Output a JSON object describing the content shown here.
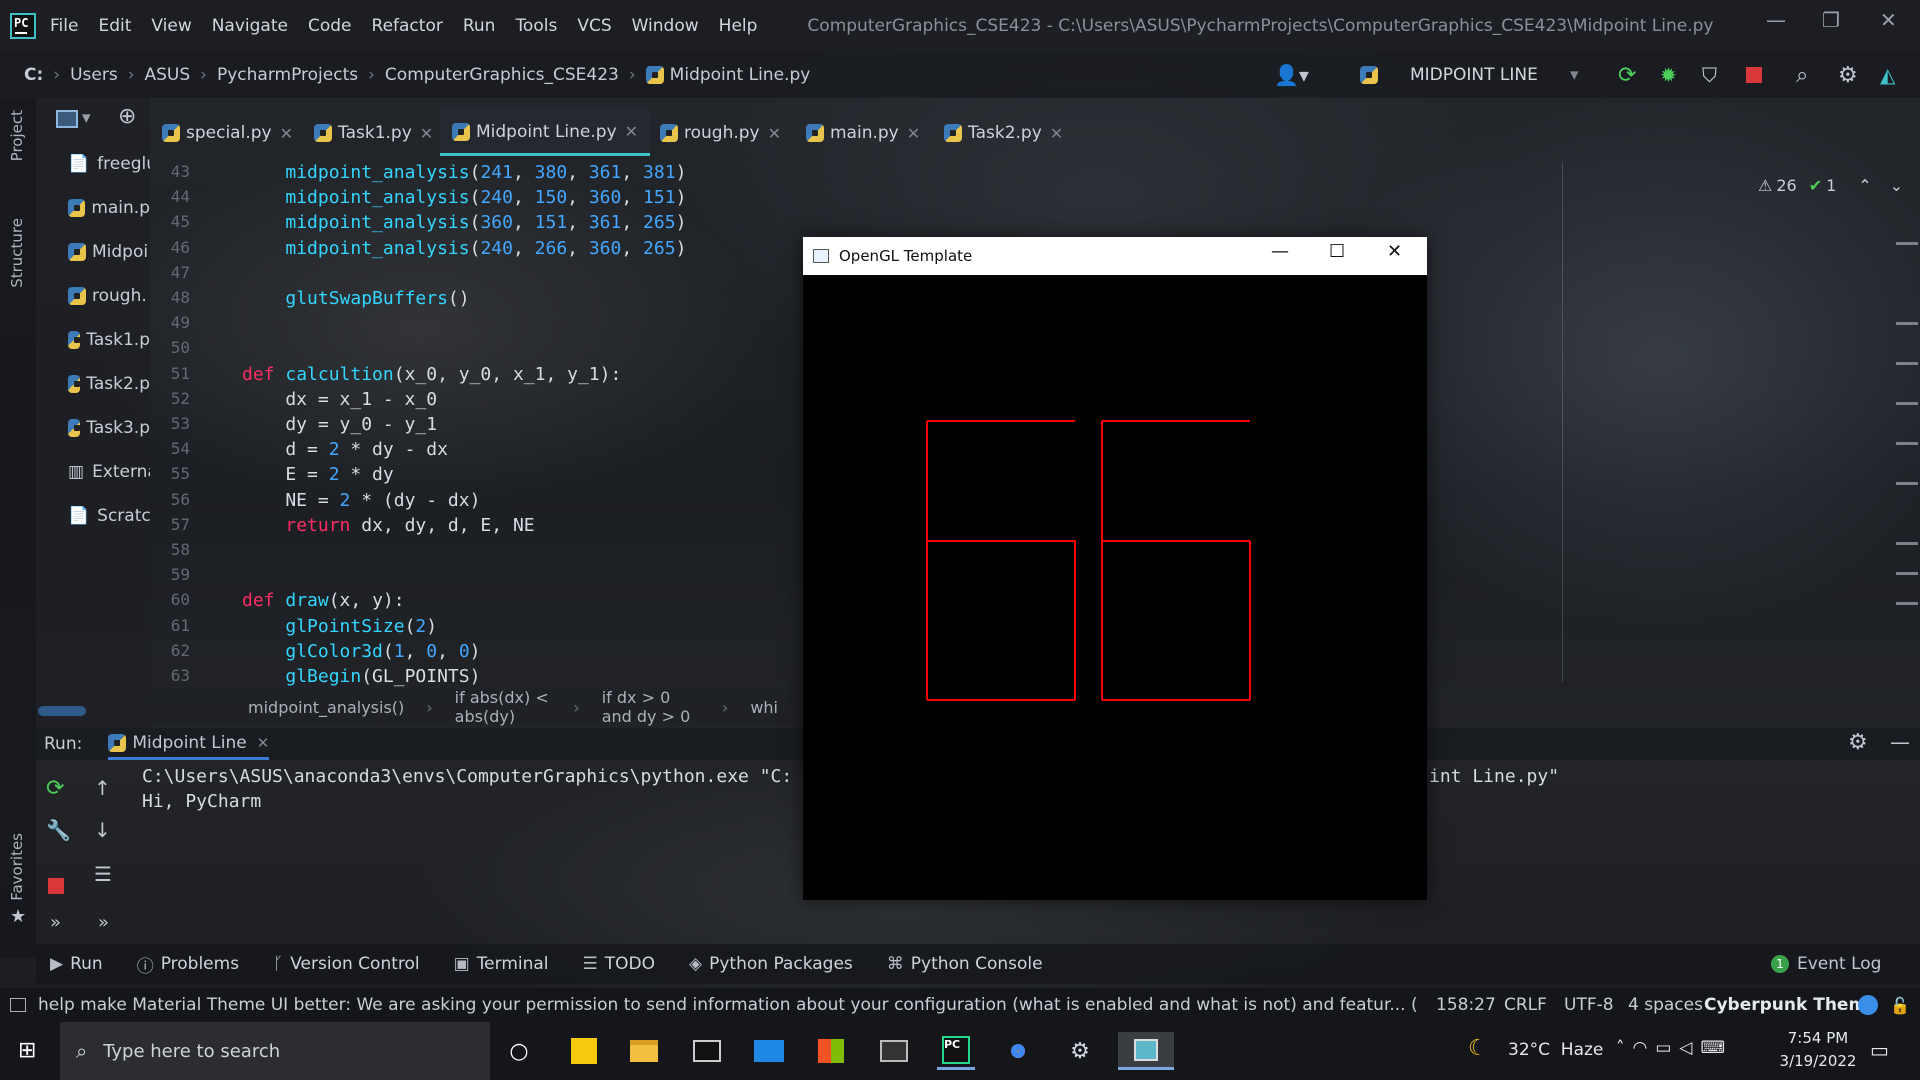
{
  "app": {
    "icon_text": "PC",
    "menu": [
      "File",
      "Edit",
      "View",
      "Navigate",
      "Code",
      "Refactor",
      "Run",
      "Tools",
      "VCS",
      "Window",
      "Help"
    ],
    "window_title": "ComputerGraphics_CSE423 - C:\\Users\\ASUS\\PycharmProjects\\ComputerGraphics_CSE423\\Midpoint Line.py"
  },
  "breadcrumb": {
    "drive": "C:",
    "parts": [
      "Users",
      "ASUS",
      "PycharmProjects",
      "ComputerGraphics_CSE423",
      "Midpoint Line.py"
    ],
    "run_config": "MIDPOINT LINE"
  },
  "project_strip": {
    "project_label": "Project",
    "structure_label": "Structure",
    "favorites_label": "Favorites"
  },
  "project_tree": [
    "freeglu",
    "main.p",
    "Midpoi",
    "rough.",
    "Task1.p",
    "Task2.p",
    "Task3.p",
    "Externa",
    "Scratch"
  ],
  "tabs": [
    "special.py",
    "Task1.py",
    "Midpoint Line.py",
    "rough.py",
    "main.py",
    "Task2.py"
  ],
  "active_tab": "Midpoint Line.py",
  "inspections": {
    "warnings": "26",
    "ok": "1"
  },
  "editor": {
    "lines": [
      {
        "n": "43",
        "code": "    midpoint_analysis(241, 380, 361, 381)"
      },
      {
        "n": "44",
        "code": "    midpoint_analysis(240, 150, 360, 151)"
      },
      {
        "n": "45",
        "code": "    midpoint_analysis(360, 151, 361, 265)"
      },
      {
        "n": "46",
        "code": "    midpoint_analysis(240, 266, 360, 265)"
      },
      {
        "n": "47",
        "code": ""
      },
      {
        "n": "48",
        "code": "    glutSwapBuffers()"
      },
      {
        "n": "49",
        "code": ""
      },
      {
        "n": "50",
        "code": ""
      },
      {
        "n": "51",
        "code": "def calcultion(x_0, y_0, x_1, y_1):"
      },
      {
        "n": "52",
        "code": "    dx = x_1 - x_0"
      },
      {
        "n": "53",
        "code": "    dy = y_0 - y_1"
      },
      {
        "n": "54",
        "code": "    d = 2 * dy - dx"
      },
      {
        "n": "55",
        "code": "    E = 2 * dy"
      },
      {
        "n": "56",
        "code": "    NE = 2 * (dy - dx)"
      },
      {
        "n": "57",
        "code": "    return dx, dy, d, E, NE"
      },
      {
        "n": "58",
        "code": ""
      },
      {
        "n": "59",
        "code": ""
      },
      {
        "n": "60",
        "code": "def draw(x, y):"
      },
      {
        "n": "61",
        "code": "    glPointSize(2)"
      },
      {
        "n": "62",
        "code": "    glColor3d(1, 0, 0)"
      },
      {
        "n": "63",
        "code": "    glBegin(GL_POINTS)"
      }
    ],
    "code_breadcrumb": [
      "midpoint_analysis()",
      "if abs(dx) < abs(dy)",
      "if dx > 0 and dy > 0",
      "whi"
    ]
  },
  "run_panel": {
    "label": "Run:",
    "tab": "Midpoint Line",
    "console": [
      "C:\\Users\\ASUS\\anaconda3\\envs\\ComputerGraphics\\python.exe \"C:",
      "Hi, PyCharm"
    ],
    "console_tail": "int Line.py\""
  },
  "opengl_window": {
    "title": "OpenGL Template",
    "line_color": "#ff0000"
  },
  "tool_windows": [
    "Run",
    "Problems",
    "Version Control",
    "Terminal",
    "TODO",
    "Python Packages",
    "Python Console"
  ],
  "event_log": {
    "count": "1",
    "label": "Event Log"
  },
  "status": {
    "message": "help make Material Theme UI better: We are asking your permission to send information about your configuration (what is enabled and what is not) and featur... (a minute ago)",
    "position": "158:27",
    "line_sep": "CRLF",
    "encoding": "UTF-8",
    "indent": "4 spaces",
    "theme": "Cyberpunk Theme"
  },
  "taskbar": {
    "search_placeholder": "Type here to search",
    "weather": "32°C  Haze",
    "time": "7:54 PM",
    "date": "3/19/2022"
  },
  "colors": {
    "keyword": "#ff2d62",
    "function": "#33d6ff",
    "number": "#43a7ff",
    "accent": "#3ec2c8"
  }
}
